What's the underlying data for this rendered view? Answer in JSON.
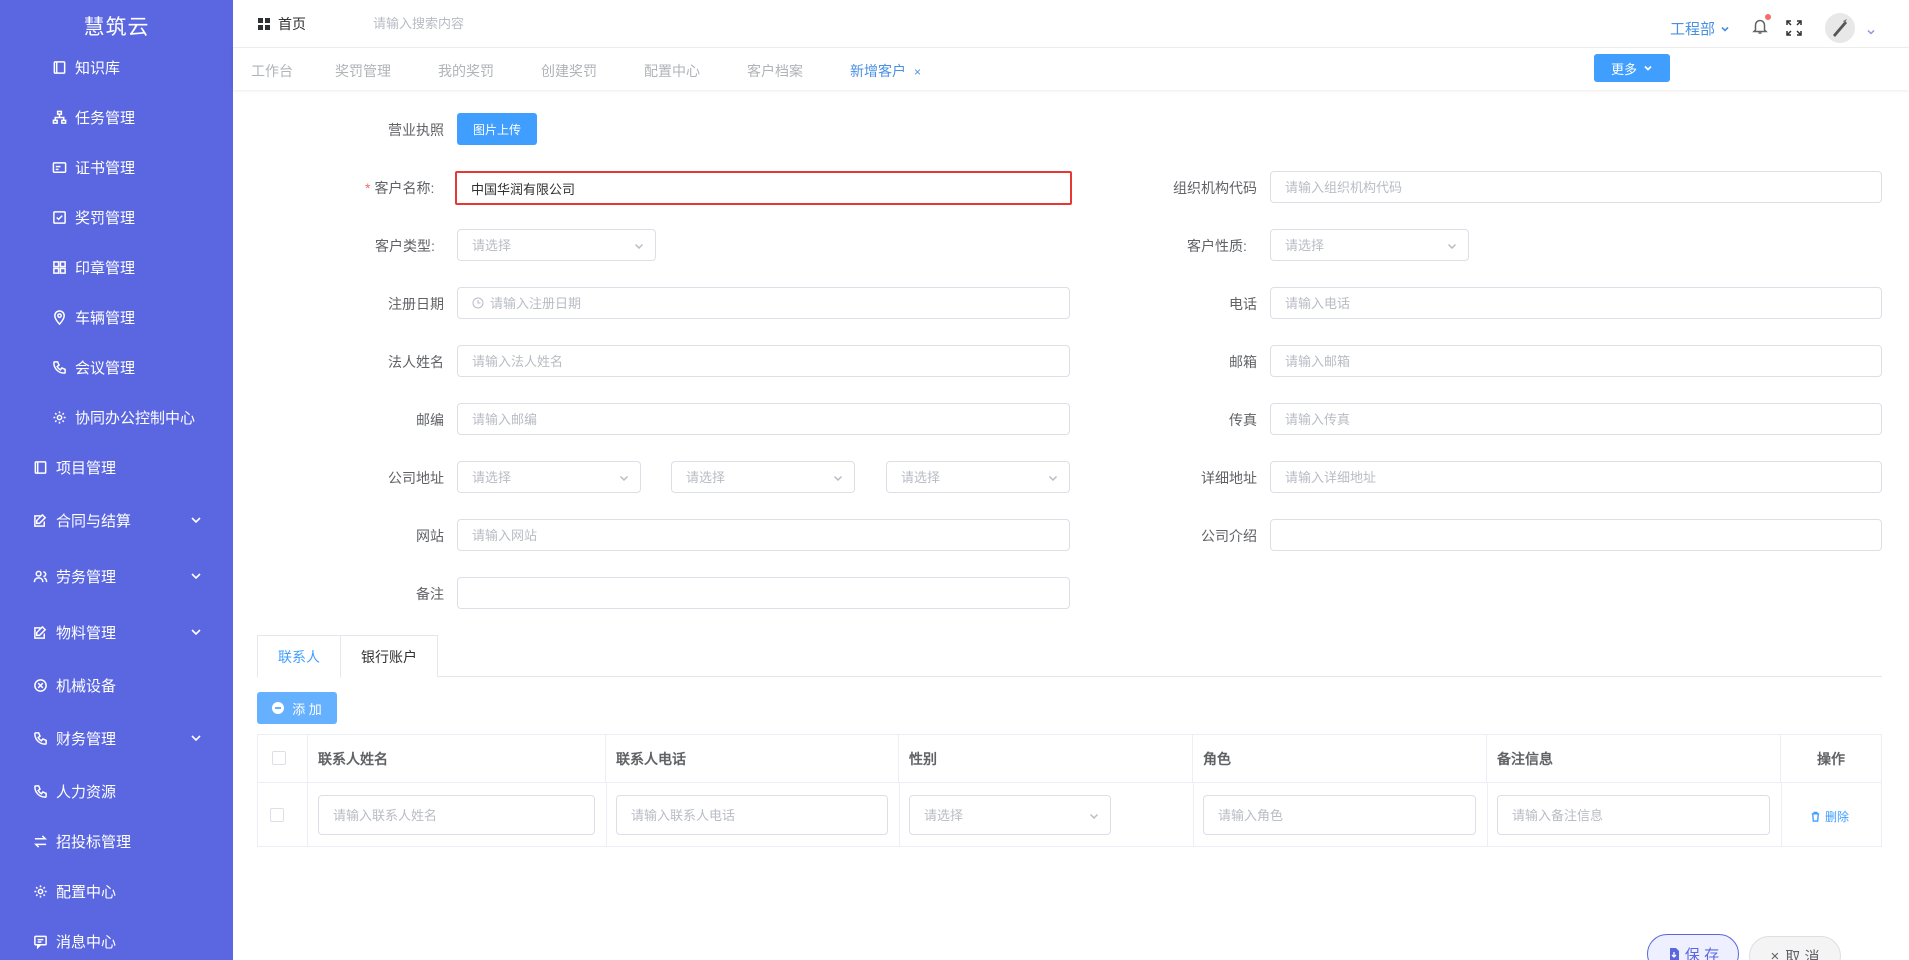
{
  "sidebar": {
    "brand": "慧筑云",
    "sub_items": [
      {
        "label": "知识库",
        "icon": "book-icon"
      },
      {
        "label": "任务管理",
        "icon": "org-chart-icon"
      },
      {
        "label": "证书管理",
        "icon": "certificate-icon"
      },
      {
        "label": "奖罚管理",
        "icon": "checkbox-icon"
      },
      {
        "label": "印章管理",
        "icon": "grid-icon"
      },
      {
        "label": "车辆管理",
        "icon": "location-icon"
      },
      {
        "label": "会议管理",
        "icon": "phone-icon"
      },
      {
        "label": "协同办公控制中心",
        "icon": "gear-icon"
      }
    ],
    "top_items": [
      {
        "label": "项目管理",
        "icon": "book-icon",
        "expandable": false
      },
      {
        "label": "合同与结算",
        "icon": "edit-icon",
        "expandable": true
      },
      {
        "label": "劳务管理",
        "icon": "users-icon",
        "expandable": true
      },
      {
        "label": "物料管理",
        "icon": "edit-icon",
        "expandable": true
      },
      {
        "label": "机械设备",
        "icon": "circle-x-icon",
        "expandable": false
      },
      {
        "label": "财务管理",
        "icon": "phone-icon",
        "expandable": true
      },
      {
        "label": "人力资源",
        "icon": "phone-icon",
        "expandable": false
      },
      {
        "label": "招投标管理",
        "icon": "swap-icon",
        "expandable": false
      },
      {
        "label": "配置中心",
        "icon": "gear-icon",
        "expandable": false
      },
      {
        "label": "消息中心",
        "icon": "message-icon",
        "expandable": false
      }
    ]
  },
  "topbar": {
    "home_label": "首页",
    "search_placeholder": "请输入搜索内容",
    "department": "工程部"
  },
  "tags": {
    "items": [
      "工作台",
      "奖罚管理",
      "我的奖罚",
      "创建奖罚",
      "配置中心",
      "客户档案",
      "新增客户"
    ],
    "active": "新增客户",
    "close_symbol": "×",
    "more_label": "更多"
  },
  "form": {
    "license": {
      "label": "营业执照",
      "button": "图片上传"
    },
    "customer_name": {
      "label": "客户名称:",
      "required_mark": "*",
      "value": "中国华润有限公司"
    },
    "org_code": {
      "label": "组织机构代码",
      "placeholder": "请输入组织机构代码"
    },
    "customer_type": {
      "label": "客户类型:",
      "placeholder": "请选择"
    },
    "customer_nature": {
      "label": "客户性质:",
      "placeholder": "请选择"
    },
    "reg_date": {
      "label": "注册日期",
      "placeholder": "请输入注册日期"
    },
    "phone": {
      "label": "电话",
      "placeholder": "请输入电话"
    },
    "legal_name": {
      "label": "法人姓名",
      "placeholder": "请输入法人姓名"
    },
    "email": {
      "label": "邮箱",
      "placeholder": "请输入邮箱"
    },
    "postcode": {
      "label": "邮编",
      "placeholder": "请输入邮编"
    },
    "fax": {
      "label": "传真",
      "placeholder": "请输入传真"
    },
    "address": {
      "label": "公司地址",
      "placeholder1": "请选择",
      "placeholder2": "请选择",
      "placeholder3": "请选择"
    },
    "detail_address": {
      "label": "详细地址",
      "placeholder": "请输入详细地址"
    },
    "website": {
      "label": "网站",
      "placeholder": "请输入网站"
    },
    "intro": {
      "label": "公司介绍",
      "placeholder": ""
    },
    "remark": {
      "label": "备注",
      "placeholder": ""
    }
  },
  "tabs": {
    "contacts": "联系人",
    "bank": "银行账户"
  },
  "add_button": "添 加",
  "table": {
    "headers": [
      "联系人姓名",
      "联系人电话",
      "性别",
      "角色",
      "备注信息",
      "操作"
    ],
    "row": {
      "name_placeholder": "请输入联系人姓名",
      "phone_placeholder": "请输入联系人电话",
      "gender_placeholder": "请选择",
      "role_placeholder": "请输入角色",
      "remark_placeholder": "请输入备注信息",
      "delete_label": "删除"
    }
  },
  "footer": {
    "save": "保 存",
    "cancel": "取 消",
    "cancel_symbol": "×"
  },
  "colors": {
    "sidebar": "#5a67e0",
    "accent": "#409eff",
    "required": "#f56c6c",
    "focus_border": "#e53935"
  }
}
